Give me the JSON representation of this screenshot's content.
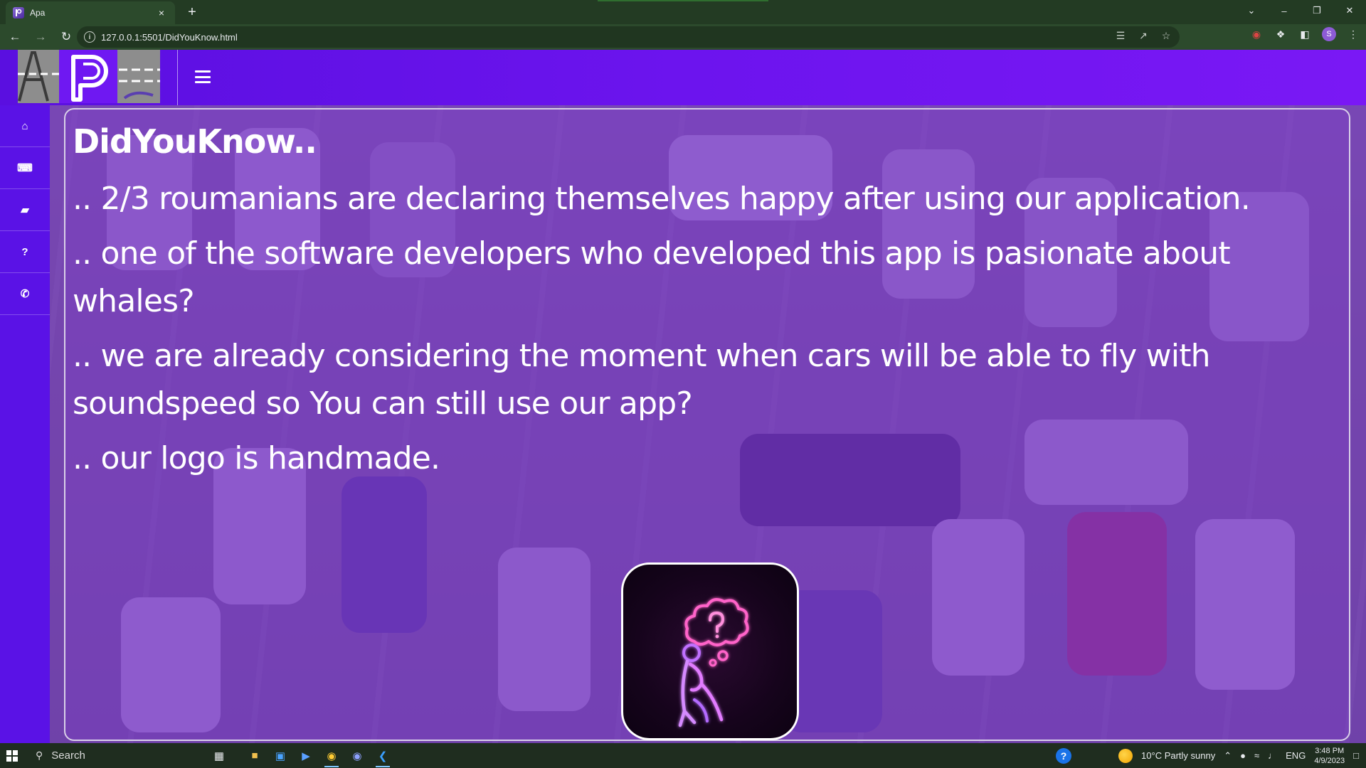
{
  "browser": {
    "tab_title": "Apa",
    "tab_close": "×",
    "new_tab": "+",
    "url": "127.0.0.1:5501/DidYouKnow.html",
    "profile_initial": "S",
    "window_controls": {
      "dropdown": "⌄",
      "minimize": "–",
      "restore": "❐",
      "close": "✕"
    }
  },
  "page": {
    "title": "DidYouKnow..",
    "facts": [
      ".. 2/3 roumanians are declaring themselves happy after using our application.",
      ".. one of the software developers who developed this app is pasionate about whales?",
      ".. we are already considering the moment when cars will be able to fly with soundspeed so You can still use our app?",
      ".. our logo is handmade."
    ],
    "sidebar_icons": [
      "home-icon",
      "keyboard-icon",
      "book-icon",
      "question-icon",
      "phone-icon"
    ],
    "sidebar_glyphs": [
      "⌂",
      "⌨",
      "▰",
      "?",
      "✆"
    ],
    "menu_icon": "hamburger-menu-icon",
    "colors": {
      "header": "#6212ea",
      "sidebar": "#5a12e6",
      "tint": "#6828be",
      "card_border": "#ffffff",
      "neon": "#ff5ec8"
    }
  },
  "taskbar": {
    "search_label": "Search",
    "weather": "10°C  Partly sunny",
    "language": "ENG",
    "time": "3:48 PM",
    "date": "4/9/2023"
  }
}
